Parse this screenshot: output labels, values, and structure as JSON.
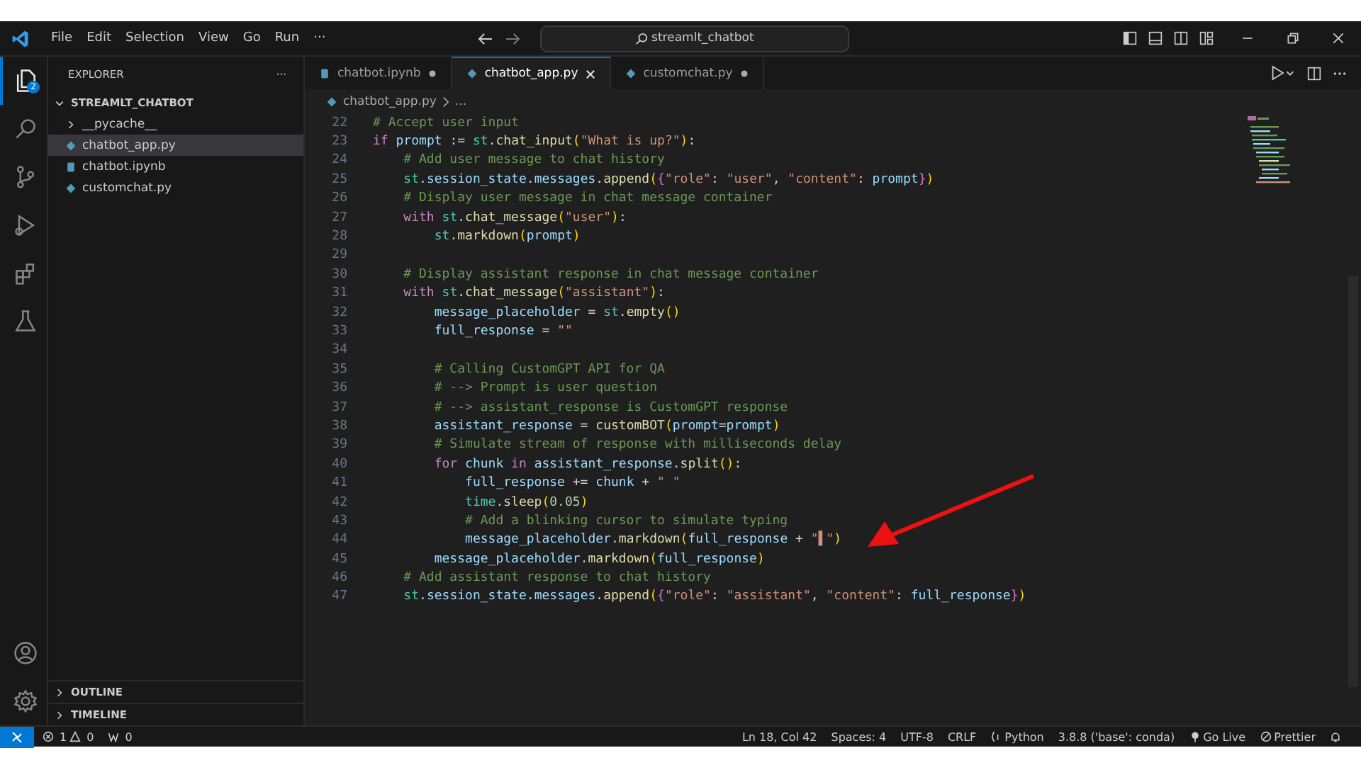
{
  "title_bar": {
    "menu": [
      "File",
      "Edit",
      "Selection",
      "View",
      "Go",
      "Run"
    ],
    "overflow": "···",
    "search": "streamlt_chatbot"
  },
  "activity_bar": {
    "items": [
      {
        "kind": "files",
        "selected": true,
        "badge": "2"
      },
      {
        "kind": "search",
        "selected": false
      },
      {
        "kind": "source-control",
        "selected": false
      },
      {
        "kind": "run",
        "selected": false
      },
      {
        "kind": "extensions",
        "selected": false
      },
      {
        "kind": "flask",
        "selected": false
      }
    ],
    "bottom": [
      {
        "kind": "account"
      },
      {
        "kind": "settings"
      }
    ]
  },
  "sidebar": {
    "title": "EXPLORER",
    "more": "···",
    "tree": [
      {
        "label": "STREAMLT_CHATBOT",
        "kind": "root",
        "expanded": true,
        "selected": false,
        "children": [
          {
            "label": "__pycache__",
            "kind": "folder",
            "expanded": false,
            "selected": false
          },
          {
            "label": "chatbot_app.py",
            "kind": "python",
            "selected": true
          },
          {
            "label": "chatbot.ipynb",
            "kind": "notebook",
            "selected": false
          },
          {
            "label": "customchat.py",
            "kind": "python",
            "selected": false
          }
        ]
      }
    ],
    "sections": [
      {
        "label": "OUTLINE",
        "expanded": false
      },
      {
        "label": "TIMELINE",
        "expanded": false
      }
    ]
  },
  "tabs": [
    {
      "label": "chatbot.ipynb",
      "kind": "notebook",
      "selected": false,
      "dirty": true
    },
    {
      "label": "chatbot_app.py",
      "kind": "python",
      "selected": true,
      "dirty": false
    },
    {
      "label": "customchat.py",
      "kind": "python",
      "selected": false,
      "dirty": true
    }
  ],
  "breadcrumb": {
    "file": "chatbot_app.py",
    "rest": "..."
  },
  "editor": {
    "lines": [
      {
        "n": "22",
        "tokens": [
          {
            "kind": "comment",
            "text": "# Accept user input"
          }
        ]
      },
      {
        "n": "23",
        "tokens": [
          {
            "kind": "keyword",
            "text": "if "
          },
          {
            "kind": "variable",
            "text": "prompt"
          },
          {
            "kind": "plain",
            "text": " := "
          },
          {
            "kind": "module",
            "text": "st"
          },
          {
            "kind": "plain",
            "text": "."
          },
          {
            "kind": "function",
            "text": "chat_input"
          },
          {
            "kind": "bracket",
            "text": "("
          },
          {
            "kind": "string",
            "text": "\"What is up?\""
          },
          {
            "kind": "bracket",
            "text": ")"
          },
          {
            "kind": "plain",
            "text": ":"
          }
        ]
      },
      {
        "n": "24",
        "tokens": [
          {
            "kind": "comment",
            "text": "    # Add user message to chat history"
          }
        ]
      },
      {
        "n": "25",
        "tokens": [
          {
            "kind": "module",
            "text": "    st"
          },
          {
            "kind": "plain",
            "text": "."
          },
          {
            "kind": "variable",
            "text": "session_state"
          },
          {
            "kind": "plain",
            "text": "."
          },
          {
            "kind": "variable",
            "text": "messages"
          },
          {
            "kind": "plain",
            "text": "."
          },
          {
            "kind": "function",
            "text": "append"
          },
          {
            "kind": "bracket",
            "text": "("
          },
          {
            "kind": "brace",
            "text": "{"
          },
          {
            "kind": "string",
            "text": "\"role\""
          },
          {
            "kind": "plain",
            "text": ": "
          },
          {
            "kind": "string",
            "text": "\"user\""
          },
          {
            "kind": "plain",
            "text": ", "
          },
          {
            "kind": "string",
            "text": "\"content\""
          },
          {
            "kind": "plain",
            "text": ": "
          },
          {
            "kind": "variable",
            "text": "prompt"
          },
          {
            "kind": "brace",
            "text": "}"
          },
          {
            "kind": "bracket",
            "text": ")"
          }
        ]
      },
      {
        "n": "26",
        "tokens": [
          {
            "kind": "comment",
            "text": "    # Display user message in chat message container"
          }
        ]
      },
      {
        "n": "27",
        "tokens": [
          {
            "kind": "keyword",
            "text": "    with "
          },
          {
            "kind": "module",
            "text": "st"
          },
          {
            "kind": "plain",
            "text": "."
          },
          {
            "kind": "function",
            "text": "chat_message"
          },
          {
            "kind": "bracket",
            "text": "("
          },
          {
            "kind": "string",
            "text": "\"user\""
          },
          {
            "kind": "bracket",
            "text": ")"
          },
          {
            "kind": "plain",
            "text": ":"
          }
        ]
      },
      {
        "n": "28",
        "tokens": [
          {
            "kind": "module",
            "text": "        st"
          },
          {
            "kind": "plain",
            "text": "."
          },
          {
            "kind": "function",
            "text": "markdown"
          },
          {
            "kind": "bracket",
            "text": "("
          },
          {
            "kind": "variable",
            "text": "prompt"
          },
          {
            "kind": "bracket",
            "text": ")"
          }
        ]
      },
      {
        "n": "29"
      },
      {
        "n": "30",
        "tokens": [
          {
            "kind": "comment",
            "text": "    # Display assistant response in chat message container"
          }
        ]
      },
      {
        "n": "31",
        "tokens": [
          {
            "kind": "keyword",
            "text": "    with "
          },
          {
            "kind": "module",
            "text": "st"
          },
          {
            "kind": "plain",
            "text": "."
          },
          {
            "kind": "function",
            "text": "chat_message"
          },
          {
            "kind": "bracket",
            "text": "("
          },
          {
            "kind": "string",
            "text": "\"assistant\""
          },
          {
            "kind": "bracket",
            "text": ")"
          },
          {
            "kind": "plain",
            "text": ":"
          }
        ]
      },
      {
        "n": "32",
        "tokens": [
          {
            "kind": "variable",
            "text": "        message_placeholder"
          },
          {
            "kind": "plain",
            "text": " = "
          },
          {
            "kind": "module",
            "text": "st"
          },
          {
            "kind": "plain",
            "text": "."
          },
          {
            "kind": "function",
            "text": "empty"
          },
          {
            "kind": "bracket",
            "text": "()"
          }
        ]
      },
      {
        "n": "33",
        "tokens": [
          {
            "kind": "variable",
            "text": "        full_response"
          },
          {
            "kind": "plain",
            "text": " = "
          },
          {
            "kind": "string",
            "text": "\"\""
          }
        ]
      },
      {
        "n": "34"
      },
      {
        "n": "35",
        "tokens": [
          {
            "kind": "comment",
            "text": "        # Calling CustomGPT API for QA"
          }
        ]
      },
      {
        "n": "36",
        "tokens": [
          {
            "kind": "comment",
            "text": "        # --> Prompt is user question"
          }
        ]
      },
      {
        "n": "37",
        "tokens": [
          {
            "kind": "comment",
            "text": "        # --> assistant_response is CustomGPT response"
          }
        ]
      },
      {
        "n": "38",
        "tokens": [
          {
            "kind": "variable",
            "text": "        assistant_response"
          },
          {
            "kind": "plain",
            "text": " = "
          },
          {
            "kind": "function",
            "text": "customBOT"
          },
          {
            "kind": "bracket",
            "text": "("
          },
          {
            "kind": "variable",
            "text": "prompt"
          },
          {
            "kind": "plain",
            "text": "="
          },
          {
            "kind": "variable",
            "text": "prompt"
          },
          {
            "kind": "bracket",
            "text": ")"
          }
        ]
      },
      {
        "n": "39",
        "tokens": [
          {
            "kind": "comment",
            "text": "        # Simulate stream of response with milliseconds delay"
          }
        ]
      },
      {
        "n": "40",
        "tokens": [
          {
            "kind": "keyword",
            "text": "        for "
          },
          {
            "kind": "variable",
            "text": "chunk"
          },
          {
            "kind": "keyword",
            "text": " in "
          },
          {
            "kind": "variable",
            "text": "assistant_response"
          },
          {
            "kind": "plain",
            "text": "."
          },
          {
            "kind": "function",
            "text": "split"
          },
          {
            "kind": "bracket",
            "text": "()"
          },
          {
            "kind": "plain",
            "text": ":"
          }
        ]
      },
      {
        "n": "41",
        "tokens": [
          {
            "kind": "variable",
            "text": "            full_response"
          },
          {
            "kind": "plain",
            "text": " += "
          },
          {
            "kind": "variable",
            "text": "chunk"
          },
          {
            "kind": "plain",
            "text": " + "
          },
          {
            "kind": "string",
            "text": "\" \""
          }
        ]
      },
      {
        "n": "42",
        "tokens": [
          {
            "kind": "module",
            "text": "            time"
          },
          {
            "kind": "plain",
            "text": "."
          },
          {
            "kind": "function",
            "text": "sleep"
          },
          {
            "kind": "bracket",
            "text": "("
          },
          {
            "kind": "number",
            "text": "0.05"
          },
          {
            "kind": "bracket",
            "text": ")"
          }
        ]
      },
      {
        "n": "43",
        "tokens": [
          {
            "kind": "comment",
            "text": "            # Add a blinking cursor to simulate typing"
          }
        ]
      },
      {
        "n": "44",
        "tokens": [
          {
            "kind": "variable",
            "text": "            message_placeholder"
          },
          {
            "kind": "plain",
            "text": "."
          },
          {
            "kind": "function",
            "text": "markdown"
          },
          {
            "kind": "bracket",
            "text": "("
          },
          {
            "kind": "variable",
            "text": "full_response"
          },
          {
            "kind": "plain",
            "text": " + "
          },
          {
            "kind": "string",
            "text": "\"▌\""
          },
          {
            "kind": "bracket",
            "text": ")"
          }
        ]
      },
      {
        "n": "45",
        "tokens": [
          {
            "kind": "variable",
            "text": "        message_placeholder"
          },
          {
            "kind": "plain",
            "text": "."
          },
          {
            "kind": "function",
            "text": "markdown"
          },
          {
            "kind": "bracket",
            "text": "("
          },
          {
            "kind": "variable",
            "text": "full_response"
          },
          {
            "kind": "bracket",
            "text": ")"
          }
        ]
      },
      {
        "n": "46",
        "tokens": [
          {
            "kind": "comment",
            "text": "    # Add assistant response to chat history"
          }
        ]
      },
      {
        "n": "47",
        "tokens": [
          {
            "kind": "module",
            "text": "    st"
          },
          {
            "kind": "plain",
            "text": "."
          },
          {
            "kind": "variable",
            "text": "session_state"
          },
          {
            "kind": "plain",
            "text": "."
          },
          {
            "kind": "variable",
            "text": "messages"
          },
          {
            "kind": "plain",
            "text": "."
          },
          {
            "kind": "function",
            "text": "append"
          },
          {
            "kind": "bracket",
            "text": "("
          },
          {
            "kind": "brace",
            "text": "{"
          },
          {
            "kind": "string",
            "text": "\"role\""
          },
          {
            "kind": "plain",
            "text": ": "
          },
          {
            "kind": "string",
            "text": "\"assistant\""
          },
          {
            "kind": "plain",
            "text": ", "
          },
          {
            "kind": "string",
            "text": "\"content\""
          },
          {
            "kind": "plain",
            "text": ": "
          },
          {
            "kind": "variable",
            "text": "full_response"
          },
          {
            "kind": "brace",
            "text": "}"
          },
          {
            "kind": "bracket",
            "text": ")"
          }
        ]
      }
    ]
  },
  "status_bar": {
    "problems": [
      {
        "kind": "error",
        "count": "1"
      },
      {
        "kind": "warning",
        "count": "0"
      },
      {
        "kind": "ports",
        "count": "0"
      }
    ],
    "right": [
      {
        "kind": "text",
        "label": "Ln 18, Col 42"
      },
      {
        "kind": "text",
        "label": "Spaces: 4"
      },
      {
        "kind": "text",
        "label": "UTF-8"
      },
      {
        "kind": "text",
        "label": "CRLF"
      },
      {
        "kind": "language",
        "label": "Python"
      },
      {
        "kind": "text",
        "label": "3.8.8 ('base': conda)"
      },
      {
        "kind": "golive",
        "label": "Go Live"
      },
      {
        "kind": "prettier",
        "label": "Prettier"
      },
      {
        "kind": "bell"
      }
    ]
  }
}
